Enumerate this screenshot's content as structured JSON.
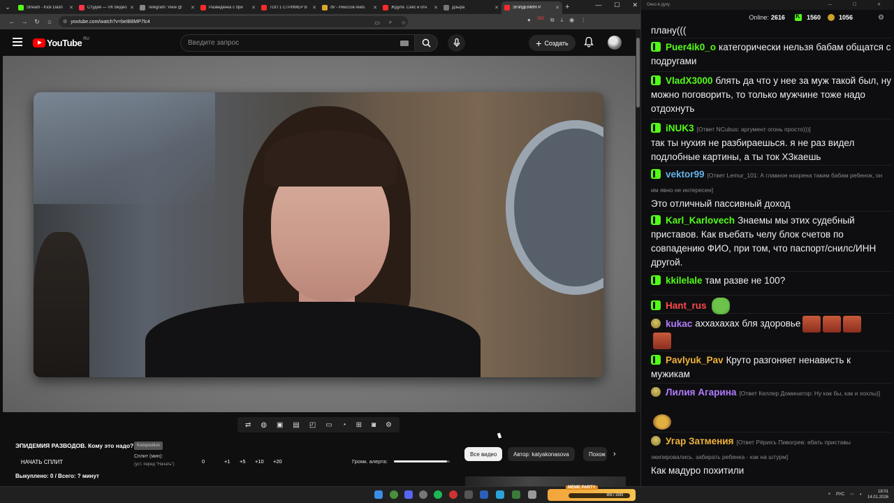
{
  "browser": {
    "tabs": [
      {
        "label": "Stream - Kick Dash",
        "color": "#53fc18"
      },
      {
        "label": "Студия — VK Видео",
        "color": "#ff3347"
      },
      {
        "label": "Telegram: View @",
        "color": "#888888"
      },
      {
        "label": "Разведёнка с при",
        "color": "#ff2a2a"
      },
      {
        "label": "ТОП 1 СТРИМЕР В",
        "color": "#ff2a2a"
      },
      {
        "label": "/b/ - Рикссов reels",
        "color": "#d9a52b"
      },
      {
        "label": "Ждуля. Секс и отн",
        "color": "#ff2a2a"
      },
      {
        "label": "Дзьіра",
        "color": "#777777"
      },
      {
        "label": "ЭПИДЕМИЯ Р",
        "color": "#ff2a2a",
        "active": true
      }
    ],
    "url": "youtube.com/watch?v=beIB8MP7lc4",
    "ext_badge": "292"
  },
  "youtube": {
    "logo_text": "YouTube",
    "region": "RU",
    "search_placeholder": "Введите запрос",
    "create_label": "Создать",
    "video_title": "ЭПИДЕМИЯ РАЗВОДОВ. Кому это надо?",
    "channel_tag": "Komposition",
    "chips": [
      "Все видео",
      "Автор: katyakonasova",
      "Похож"
    ]
  },
  "split": {
    "start_label": "НАЧАТЬ СПЛИТ",
    "label": "Сплит (мин):",
    "sublabel": "(уст. перед \"Начать\")",
    "value": "0",
    "increments": [
      "+1",
      "+5",
      "+10",
      "+20"
    ],
    "paid_out": "Выкуплено: 0 / Всего: ? минут",
    "volume_label": "Громк. алерта:",
    "volume_fraction": 0.95
  },
  "chat": {
    "window_title": "Окно в духу",
    "online_label": "Online:",
    "online_count": "2616",
    "kick_count": "1560",
    "gift_count": "1056",
    "messages": [
      {
        "text": "плану(((",
        "user": "",
        "badge": "none"
      },
      {
        "user": "Puer4ik0_o",
        "color": "#53fc18",
        "badge": "kick",
        "reply": "",
        "text": "категорически нельзя бабам общатся с подругами"
      },
      {
        "user": "VladX3000",
        "color": "#53fc18",
        "badge": "kick",
        "reply": "",
        "text": "блять да что у нее за муж такой был, ну можно поговорить, то только мужчине тоже надо отдохнуть"
      },
      {
        "user": "iNUK3",
        "color": "#53fc18",
        "badge": "kick",
        "reply": "[Ответ NCubus: аргумент огонь просто)))]",
        "text": "так ты нухия не разбираешься. я не раз видел подлобные картины, а ты ток ХЗкаешь"
      },
      {
        "user": "vektor99",
        "color": "#64b4e8",
        "badge": "kick",
        "reply": "[Ответ Lemur_101: А главное нахрена таким бабам ребенок, он им явно не интересен]",
        "text": "Это отличный пассивный доход"
      },
      {
        "user": "Karl_Karlovech",
        "color": "#53fc18",
        "badge": "kick",
        "reply": "",
        "text": "Знаемы мы этих судебный приставов. Как въебать челу блок счетов по совпадению ФИО, при том, что паспорт/снилс/ИНН другой."
      },
      {
        "user": "kkilelale",
        "color": "#53fc18",
        "badge": "kick",
        "reply": "",
        "text": "там разве не 100?"
      },
      {
        "user": "Hant_rus",
        "color": "#ff4a4a",
        "badge": "kick",
        "reply": "",
        "text": ""
      },
      {
        "user": "kukac",
        "color": "#b07cff",
        "badge": "gold",
        "reply": "",
        "text": "аххахахах бля здоровье"
      },
      {
        "user": "Pavlyuk_Pav",
        "color": "#f0b23a",
        "badge": "kick",
        "reply": "",
        "text": "Круто разгоняет ненависть к мужикам"
      },
      {
        "user": "Лилия Агарина",
        "color": "#b07cff",
        "badge": "gold",
        "reply": "[Ответ Келлер Доминатор: Ну как бы, как и хохлы)]",
        "text": ""
      },
      {
        "user": "Угар Затмения",
        "color": "#f0b23a",
        "badge": "gold",
        "reply": "[Ответ Рёрихъ Пивогрев: ебать приставы экипировались. забирать ребенка  - как на штурм]",
        "text": "Как мадуро похитили"
      }
    ]
  },
  "taskbar": {
    "widget_title": "MEME PARTY",
    "widget_progress": "959 / 1599",
    "lang": "РУС",
    "time": "18:01",
    "date": "14.01.2026"
  }
}
